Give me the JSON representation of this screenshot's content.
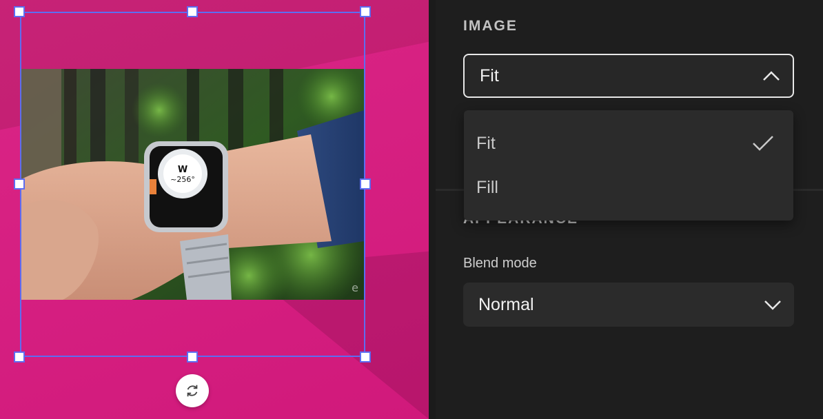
{
  "canvas": {
    "watermark": "e"
  },
  "panel": {
    "image_section_title": "IMAGE",
    "image_fit_select": {
      "value": "Fit",
      "state": "open"
    },
    "image_fit_options": [
      {
        "label": "Fit",
        "selected": true
      },
      {
        "label": "Fill",
        "selected": false
      }
    ],
    "appearance_section_title": "APPEARANCE",
    "blend_mode": {
      "label": "Blend mode",
      "value": "Normal"
    }
  },
  "icons": {
    "select_open": "chevron-up-icon",
    "select_closed": "chevron-down-icon",
    "selected_option": "checkmark-icon",
    "replace_image": "refresh-icon"
  },
  "colors": {
    "canvas_background": "#d91a80",
    "selection_outline": "#5d6df2",
    "panel_background": "#1e1e1e",
    "menu_background": "#2b2b2b"
  }
}
